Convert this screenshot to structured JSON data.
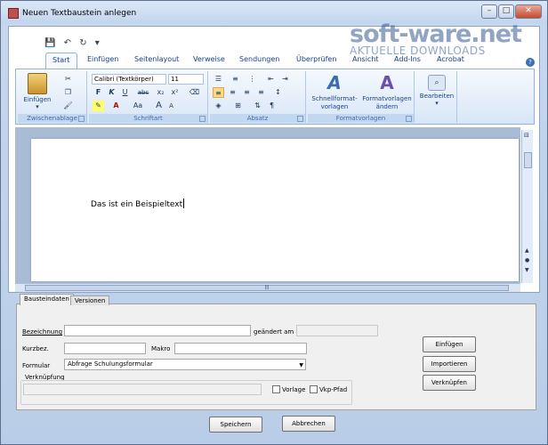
{
  "window": {
    "title": "Neuen Textbaustein anlegen",
    "min": "–",
    "max": "□",
    "close": "✕"
  },
  "watermark": {
    "line1": "soft-ware.net",
    "line2": "AKTUELLE DOWNLOADS"
  },
  "qat": {
    "save": "💾",
    "undo": "↶",
    "redo": "↻",
    "more": "▾"
  },
  "ribbon_tabs": [
    "Start",
    "Einfügen",
    "Seitenlayout",
    "Verweise",
    "Sendungen",
    "Überprüfen",
    "Ansicht",
    "Add-Ins",
    "Acrobat"
  ],
  "groups": {
    "clipboard": {
      "label": "Zwischenablage",
      "paste": "Einfügen"
    },
    "font": {
      "label": "Schriftart",
      "font_name": "Calibri (Textkörper)",
      "font_size": "11",
      "bold": "F",
      "italic": "K",
      "underline": "U",
      "strike": "abc",
      "sub": "x₂",
      "sup": "x²",
      "case": "Aa",
      "grow": "A",
      "shrink": "A"
    },
    "paragraph": {
      "label": "Absatz"
    },
    "styles": {
      "label": "Formatvorlagen",
      "quick": "Schnellformat-\nvorlagen",
      "change": "Formatvorlagen\nändern"
    },
    "edit": {
      "label": "Bearbeiten"
    }
  },
  "document": {
    "text": "Das ist ein Beispieltext"
  },
  "panel_tabs": [
    "Bausteindaten",
    "Versionen"
  ],
  "form": {
    "bezeichnung_label": "Bezeichnung",
    "bezeichnung_value": "",
    "geaendert_label": "geändert am",
    "geaendert_value": "",
    "kurzbez_label": "Kurzbez.",
    "kurzbez_value": "",
    "makro_label": "Makro",
    "makro_value": "",
    "formular_label": "Formular",
    "formular_value": "Abfrage Schulungsformular",
    "verknuepfung_label": "Verknüpfung",
    "verknuepfung_value": "",
    "vorlage_label": "Vorlage",
    "vkp_label": "Vkp-Pfad"
  },
  "side_buttons": [
    "Einfügen",
    "Importieren",
    "Verknüpfen"
  ],
  "bottom_buttons": {
    "save": "Speichern",
    "cancel": "Abbrechen"
  }
}
